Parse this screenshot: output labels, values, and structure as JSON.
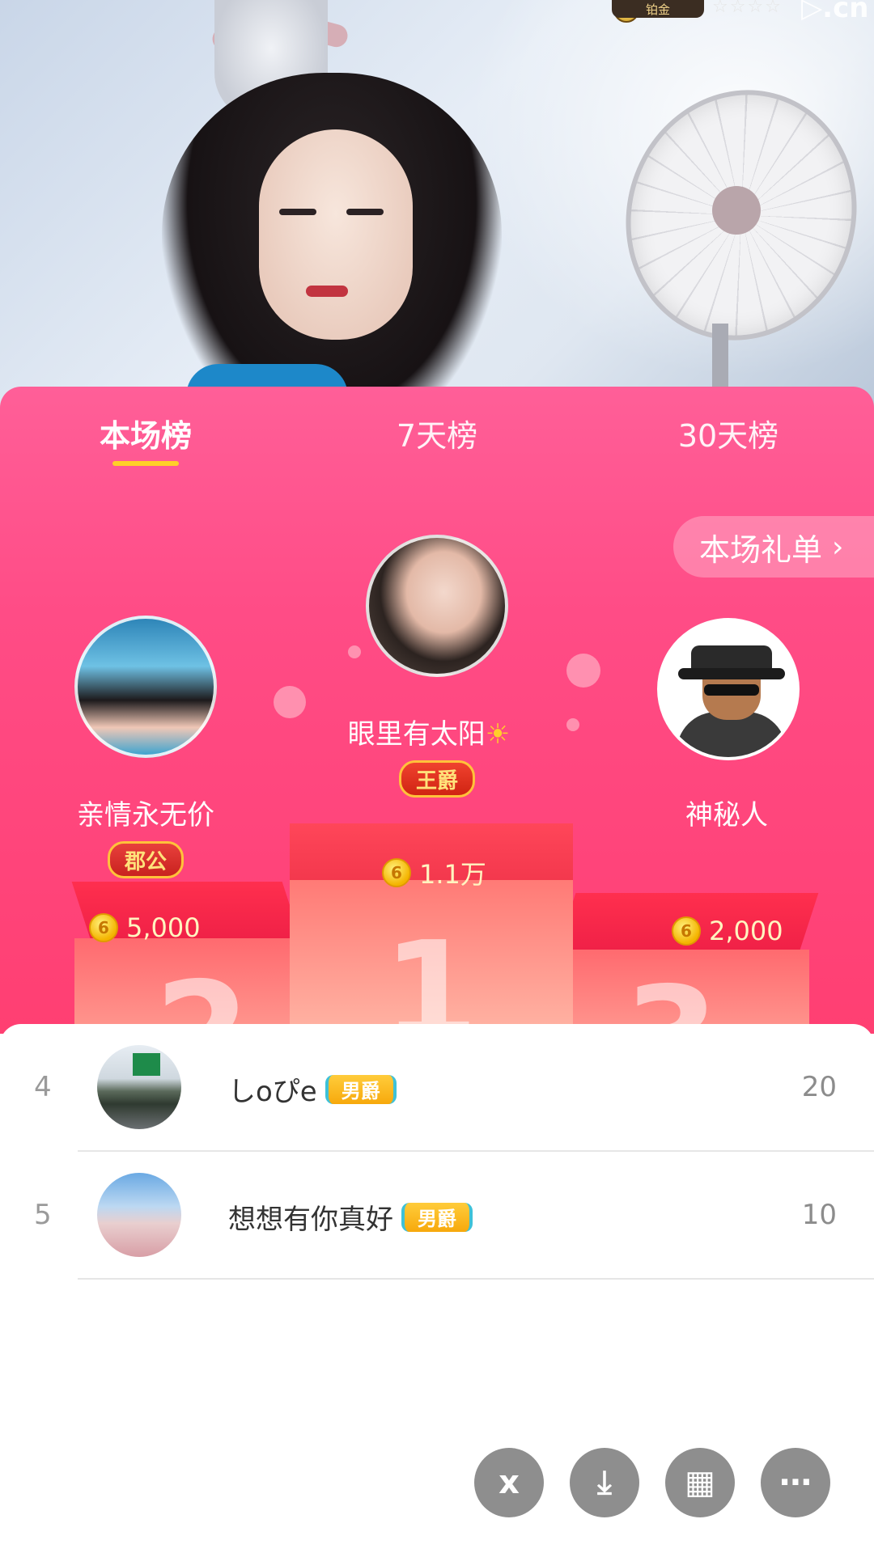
{
  "stream": {
    "level_label": "铂金",
    "watermark": "▷.cn"
  },
  "tabs": [
    {
      "label": "本场榜",
      "active": true
    },
    {
      "label": "7天榜",
      "active": false
    },
    {
      "label": "30天榜",
      "active": false
    }
  ],
  "gift_list_button": {
    "label": "本场礼单",
    "chevron": "›"
  },
  "podium": {
    "first": {
      "name": "眼里有太阳",
      "badge": "王爵",
      "score": "1.1万",
      "place": "1"
    },
    "second": {
      "name": "亲情永无价",
      "badge": "郡公",
      "score": "5,000",
      "place": "2"
    },
    "third": {
      "name": "神秘人",
      "score": "2,000",
      "place": "3"
    }
  },
  "coin_symbol": "6",
  "list": [
    {
      "rank": "4",
      "name": "しoぴe",
      "badge": "男爵",
      "value": "20"
    },
    {
      "rank": "5",
      "name": "想想有你真好",
      "badge": "男爵",
      "value": "10"
    }
  ],
  "bottom_actions": [
    {
      "icon": "share-icon",
      "glyph": "ⅹ"
    },
    {
      "icon": "download-icon",
      "glyph": "⤓"
    },
    {
      "icon": "grid-icon",
      "glyph": "▦"
    },
    {
      "icon": "more-icon",
      "glyph": "⋯"
    }
  ],
  "colors": {
    "panel_top": "#ff5f98",
    "panel_bottom": "#ff3f72",
    "tab_indicator": "#ffd028",
    "noble_badge": "#f7a90c"
  }
}
